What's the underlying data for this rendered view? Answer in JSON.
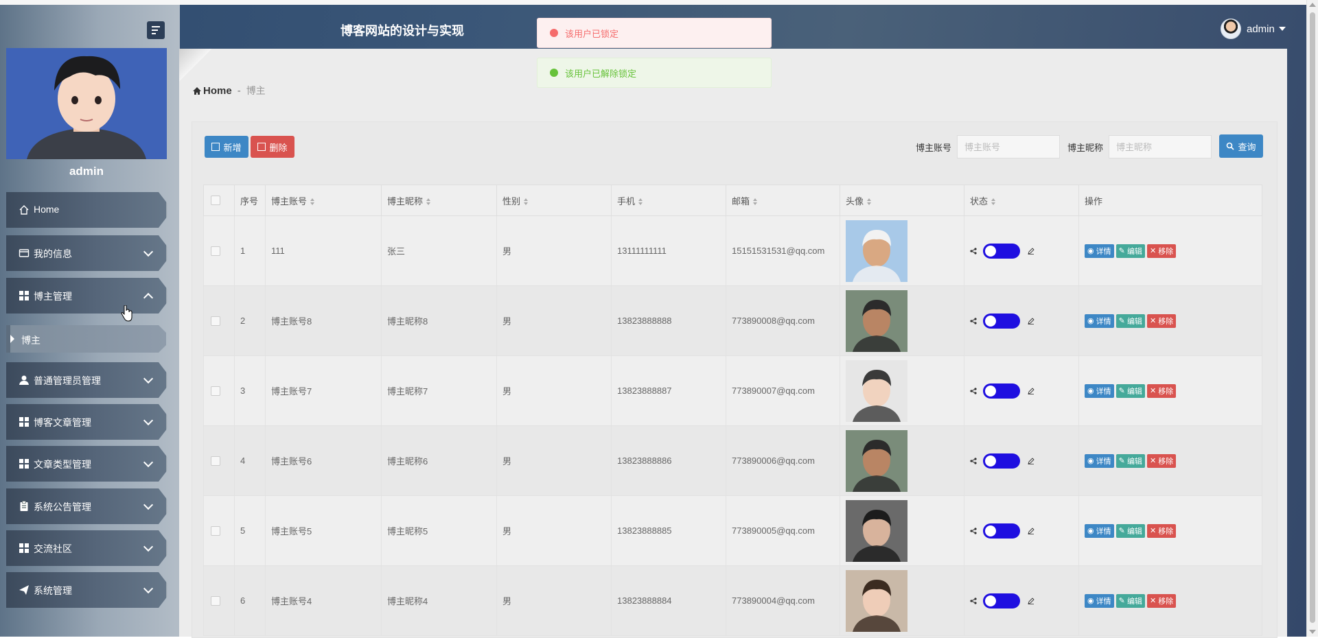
{
  "header": {
    "site_title": "博客网站的设计与实现",
    "user": "admin"
  },
  "sidebar": {
    "username": "admin",
    "items": [
      {
        "label": "Home",
        "icon": "home-icon"
      },
      {
        "label": "我的信息",
        "icon": "card-icon"
      },
      {
        "label": "博主管理",
        "icon": "grid-icon",
        "expanded": true
      },
      {
        "label": "普通管理员管理",
        "icon": "person-icon"
      },
      {
        "label": "博客文章管理",
        "icon": "grid-icon"
      },
      {
        "label": "文章类型管理",
        "icon": "grid-icon"
      },
      {
        "label": "系统公告管理",
        "icon": "clipboard-icon"
      },
      {
        "label": "交流社区",
        "icon": "grid-icon"
      },
      {
        "label": "系统管理",
        "icon": "send-icon"
      }
    ],
    "sub_item": "博主"
  },
  "breadcrumb": {
    "home": "Home",
    "separator": "-",
    "current": "博主"
  },
  "toolbar": {
    "add_label": "新增",
    "delete_label": "删除",
    "account_label": "博主账号",
    "account_placeholder": "博主账号",
    "nickname_label": "博主昵称",
    "nickname_placeholder": "博主昵称",
    "query_label": "查询"
  },
  "toasts": {
    "error": "该用户已锁定",
    "success": "该用户已解除锁定"
  },
  "table": {
    "headers": [
      "序号",
      "博主账号",
      "博主昵称",
      "性别",
      "手机",
      "邮箱",
      "头像",
      "状态",
      "操作"
    ],
    "rows": [
      {
        "no": "1",
        "account": "111",
        "nickname": "张三",
        "gender": "男",
        "phone": "13111111111",
        "email": "15151531531@qq.com"
      },
      {
        "no": "2",
        "account": "博主账号8",
        "nickname": "博主昵称8",
        "gender": "男",
        "phone": "13823888888",
        "email": "773890008@qq.com"
      },
      {
        "no": "3",
        "account": "博主账号7",
        "nickname": "博主昵称7",
        "gender": "男",
        "phone": "13823888887",
        "email": "773890007@qq.com"
      },
      {
        "no": "4",
        "account": "博主账号6",
        "nickname": "博主昵称6",
        "gender": "男",
        "phone": "13823888886",
        "email": "773890006@qq.com"
      },
      {
        "no": "5",
        "account": "博主账号5",
        "nickname": "博主昵称5",
        "gender": "男",
        "phone": "13823888885",
        "email": "773890005@qq.com"
      },
      {
        "no": "6",
        "account": "博主账号4",
        "nickname": "博主昵称4",
        "gender": "男",
        "phone": "13823888884",
        "email": "773890004@qq.com"
      }
    ],
    "actions": {
      "detail": "详情",
      "edit": "编辑",
      "remove": "移除"
    }
  },
  "colors": {
    "primary": "#3d87c5",
    "danger": "#d9534f",
    "teal": "#45a99a",
    "toggle": "#1f0fe0"
  }
}
